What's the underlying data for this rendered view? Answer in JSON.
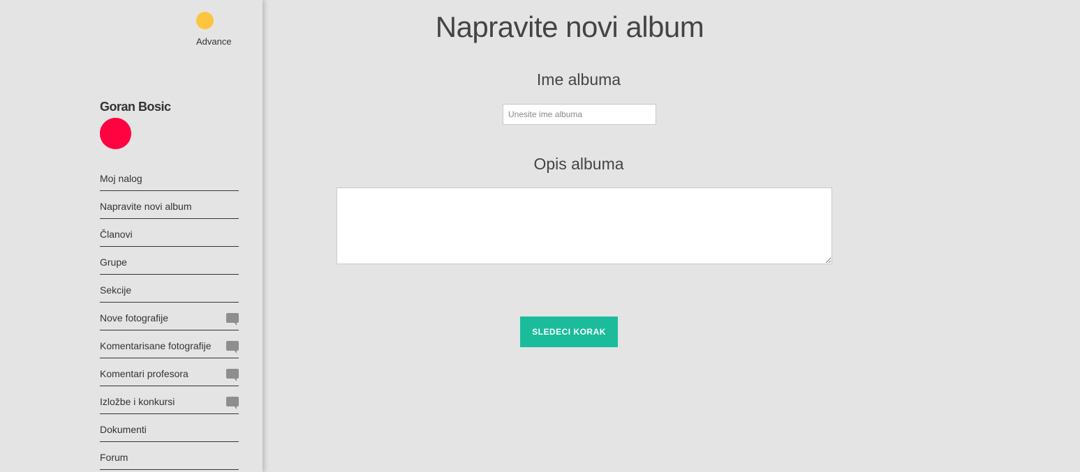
{
  "brand": {
    "label": "Advance",
    "color": "#fcc43f"
  },
  "user": {
    "name": "Goran Bosic",
    "avatar_color": "#ff0240"
  },
  "sidebar": {
    "items": [
      {
        "label": "Moj nalog",
        "icon": null
      },
      {
        "label": "Napravite novi album",
        "icon": null
      },
      {
        "label": "Članovi",
        "icon": null
      },
      {
        "label": "Grupe",
        "icon": null
      },
      {
        "label": "Sekcije",
        "icon": null
      },
      {
        "label": "Nove fotografije",
        "icon": "chat-icon"
      },
      {
        "label": "Komentarisane fotografije",
        "icon": "chat-icon"
      },
      {
        "label": "Komentari profesora",
        "icon": "chat-icon"
      },
      {
        "label": "Izložbe i konkursi",
        "icon": "chat-icon"
      },
      {
        "label": "Dokumenti",
        "icon": null
      },
      {
        "label": "Forum",
        "icon": null
      }
    ]
  },
  "main": {
    "title": "Napravite novi album",
    "name_label": "Ime albuma",
    "name_placeholder": "Unesite ime albuma",
    "name_value": "",
    "description_label": "Opis albuma",
    "description_value": "",
    "next_button": "SLEDECI KORAK",
    "accent_color": "#1abc9c"
  }
}
